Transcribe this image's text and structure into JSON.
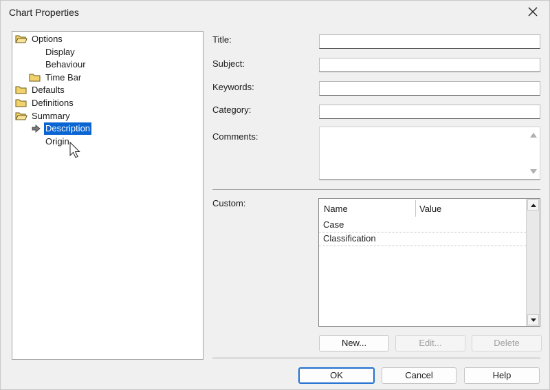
{
  "window": {
    "title": "Chart Properties"
  },
  "tree": {
    "items": [
      {
        "label": "Options",
        "icon": "folder-open-icon"
      },
      {
        "label": "Display"
      },
      {
        "label": "Behaviour"
      },
      {
        "label": "Time Bar",
        "icon": "folder-icon"
      },
      {
        "label": "Defaults",
        "icon": "folder-icon"
      },
      {
        "label": "Definitions",
        "icon": "folder-icon"
      },
      {
        "label": "Summary",
        "icon": "folder-open-icon"
      },
      {
        "label": "Description",
        "icon": "arrow-right-icon",
        "selected": true
      },
      {
        "label": "Origin"
      }
    ]
  },
  "form": {
    "title_label": "Title:",
    "title_value": "",
    "subject_label": "Subject:",
    "subject_value": "",
    "keywords_label": "Keywords:",
    "keywords_value": "",
    "category_label": "Category:",
    "category_value": "",
    "comments_label": "Comments:",
    "comments_value": "",
    "custom_label": "Custom:"
  },
  "custom_grid": {
    "columns": [
      "Name",
      "Value"
    ],
    "rows": [
      {
        "name": "Case",
        "value": ""
      },
      {
        "name": "Classification",
        "value": ""
      }
    ]
  },
  "grid_buttons": {
    "new_label": "New...",
    "edit_label": "Edit...",
    "delete_label": "Delete"
  },
  "footer": {
    "ok_label": "OK",
    "cancel_label": "Cancel",
    "help_label": "Help"
  },
  "colors": {
    "selection": "#0a64d2",
    "default_button_border": "#1f6fd0",
    "folder": "#f2d36b"
  }
}
